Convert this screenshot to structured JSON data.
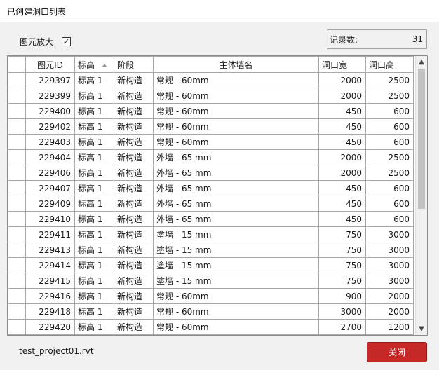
{
  "window": {
    "title": "已创建洞口列表"
  },
  "zoom": {
    "label": "图元放大",
    "checked": true,
    "check_glyph": "✓"
  },
  "record_count": {
    "label": "记录数:",
    "value": "31"
  },
  "table": {
    "columns": [
      "",
      "图元ID",
      "标高",
      "阶段",
      "主体墙名",
      "洞口宽",
      "洞口高"
    ],
    "sorted_column": "标高",
    "rows": [
      [
        "229397",
        "标高 1",
        "新构造",
        "常规 - 60mm",
        "2000",
        "2500"
      ],
      [
        "229399",
        "标高 1",
        "新构造",
        "常规 - 60mm",
        "2000",
        "2500"
      ],
      [
        "229400",
        "标高 1",
        "新构造",
        "常规 - 60mm",
        "450",
        "600"
      ],
      [
        "229402",
        "标高 1",
        "新构造",
        "常规 - 60mm",
        "450",
        "600"
      ],
      [
        "229403",
        "标高 1",
        "新构造",
        "常规 - 60mm",
        "450",
        "600"
      ],
      [
        "229404",
        "标高 1",
        "新构造",
        "外墙 - 65 mm",
        "2000",
        "2500"
      ],
      [
        "229406",
        "标高 1",
        "新构造",
        "外墙 - 65 mm",
        "2000",
        "2500"
      ],
      [
        "229407",
        "标高 1",
        "新构造",
        "外墙 - 65 mm",
        "450",
        "600"
      ],
      [
        "229409",
        "标高 1",
        "新构造",
        "外墙 - 65 mm",
        "450",
        "600"
      ],
      [
        "229410",
        "标高 1",
        "新构造",
        "外墙 - 65 mm",
        "450",
        "600"
      ],
      [
        "229411",
        "标高 1",
        "新构造",
        "塗墙 - 15 mm",
        "750",
        "3000"
      ],
      [
        "229413",
        "标高 1",
        "新构造",
        "塗墙 - 15 mm",
        "750",
        "3000"
      ],
      [
        "229414",
        "标高 1",
        "新构造",
        "塗墙 - 15 mm",
        "750",
        "3000"
      ],
      [
        "229415",
        "标高 1",
        "新构造",
        "塗墙 - 15 mm",
        "750",
        "3000"
      ],
      [
        "229416",
        "标高 1",
        "新构造",
        "常规 - 60mm",
        "900",
        "2000"
      ],
      [
        "229418",
        "标高 1",
        "新构造",
        "常规 - 60mm",
        "3000",
        "2000"
      ],
      [
        "229420",
        "标高 1",
        "新构造",
        "常规 - 60mm",
        "2700",
        "1200"
      ]
    ]
  },
  "scrollbar": {
    "up_icon": "▲",
    "down_icon": "▼"
  },
  "footer": {
    "filename": "test_project01.rvt",
    "close_label": "关闭"
  }
}
